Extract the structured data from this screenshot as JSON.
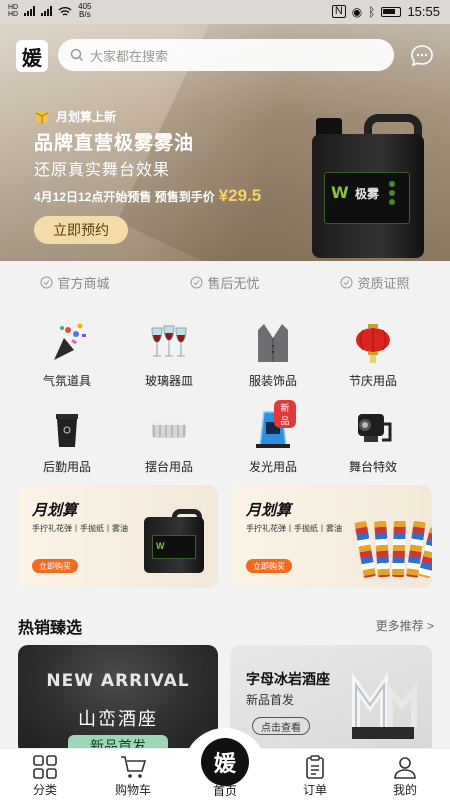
{
  "status": {
    "net_speed": "405",
    "net_unit": "B/s",
    "time": "15:55"
  },
  "header": {
    "logo_text": "媛",
    "search_placeholder": "大家都在搜索"
  },
  "promo": {
    "tag": "月划算上新",
    "title": "品牌直营极雾雾油",
    "subtitle": "还原真实舞台效果",
    "date_text": "4月12日12点开始预售 预售到手价",
    "price": "¥29.5",
    "button": "立即预约",
    "product_label": "极雾"
  },
  "assurances": [
    "官方商城",
    "售后无忧",
    "资质证照"
  ],
  "categories": [
    {
      "label": "气氛道具",
      "icon": "confetti-icon"
    },
    {
      "label": "玻璃器皿",
      "icon": "wine-glass-icon"
    },
    {
      "label": "服装饰品",
      "icon": "vest-icon"
    },
    {
      "label": "节庆用品",
      "icon": "lantern-icon"
    },
    {
      "label": "后勤用品",
      "icon": "trash-bin-icon"
    },
    {
      "label": "摆台用品",
      "icon": "ashtray-icon"
    },
    {
      "label": "发光用品",
      "icon": "led-display-icon",
      "badge": "新品"
    },
    {
      "label": "舞台特效",
      "icon": "stage-light-icon"
    }
  ],
  "cards": [
    {
      "title": "月划算",
      "subtitle": "手拧礼花弹丨手抛纸丨雾油",
      "button": "立即购买"
    },
    {
      "title": "月划算",
      "subtitle": "手拧礼花弹丨手抛纸丨雾油",
      "button": "立即购买"
    }
  ],
  "hot": {
    "title": "热销臻选",
    "more": "更多推荐 >",
    "items": [
      {
        "banner": "NEW ARRIVAL",
        "name": "山峦酒座",
        "tag": "新品首发"
      },
      {
        "name": "字母冰岩酒座",
        "sub": "新品首发",
        "button": "点击查看"
      }
    ]
  },
  "nav": {
    "tabs": [
      "分类",
      "购物车",
      "首页",
      "订单",
      "我的"
    ],
    "home_logo": "媛"
  },
  "colors": {
    "accent": "#f06a1f",
    "price": "#f7d26a",
    "promo_button": "#f4dca9",
    "brand_dark": "#111111"
  }
}
